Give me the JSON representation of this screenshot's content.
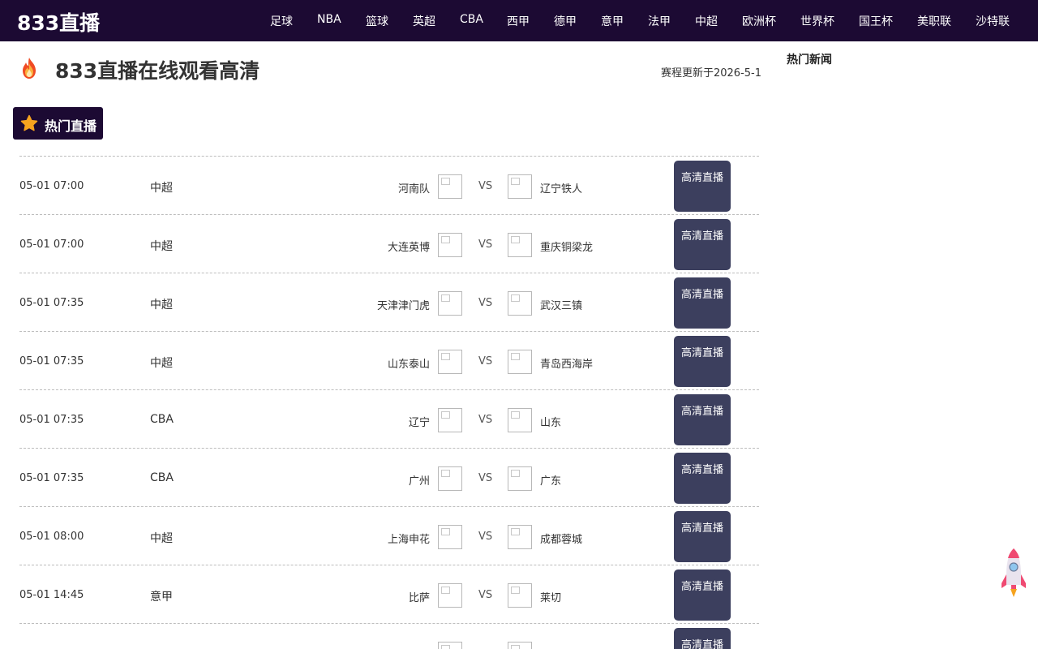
{
  "header": {
    "logo": "833直播",
    "nav": [
      "足球",
      "NBA",
      "篮球",
      "英超",
      "CBA",
      "西甲",
      "德甲",
      "意甲",
      "法甲",
      "中超",
      "欧洲杯",
      "世界杯",
      "国王杯",
      "美职联",
      "沙特联"
    ]
  },
  "page": {
    "title": "833直播在线观看高清",
    "updated": "赛程更新于2026-5-1",
    "hot_label": "热门直播",
    "side_title": "热门新闻"
  },
  "schedule": {
    "vs_label": "VS",
    "button_label": "高清直播",
    "rows": [
      {
        "time": "05-01 07:00",
        "league": "中超",
        "home": "河南队",
        "away": "辽宁铁人"
      },
      {
        "time": "05-01 07:00",
        "league": "中超",
        "home": "大连英博",
        "away": "重庆铜梁龙"
      },
      {
        "time": "05-01 07:35",
        "league": "中超",
        "home": "天津津门虎",
        "away": "武汉三镇"
      },
      {
        "time": "05-01 07:35",
        "league": "中超",
        "home": "山东泰山",
        "away": "青岛西海岸"
      },
      {
        "time": "05-01 07:35",
        "league": "CBA",
        "home": "辽宁",
        "away": "山东"
      },
      {
        "time": "05-01 07:35",
        "league": "CBA",
        "home": "广州",
        "away": "广东"
      },
      {
        "time": "05-01 08:00",
        "league": "中超",
        "home": "上海申花",
        "away": "成都蓉城"
      },
      {
        "time": "05-01 14:45",
        "league": "意甲",
        "home": "比萨",
        "away": "莱切"
      }
    ]
  },
  "colors": {
    "nav_bg": "#1c0a33",
    "button_bg": "#3c3f5e",
    "star": "#f6a31e"
  }
}
